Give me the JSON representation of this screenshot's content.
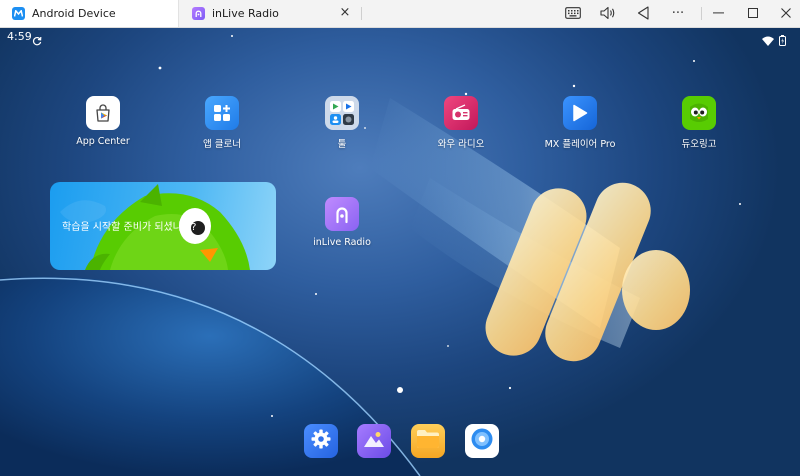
{
  "tabs": [
    {
      "label": "Android Device",
      "active": true
    },
    {
      "label": "inLive Radio",
      "active": false
    }
  ],
  "toolbar": {
    "close_tab_glyph": "×",
    "more_glyph": "···",
    "minimize_glyph": "—",
    "maximize_glyph": "☐",
    "close_glyph": "✕"
  },
  "status": {
    "time": "4:59"
  },
  "apps": [
    {
      "label": "App Center",
      "icon": "play-store-icon"
    },
    {
      "label": "앱 클로너",
      "icon": "app-cloner-icon"
    },
    {
      "label": "툴",
      "icon": "tools-folder-icon"
    },
    {
      "label": "와우 라디오",
      "icon": "radio-icon"
    },
    {
      "label": "MX 플레이어 Pro",
      "icon": "mx-player-icon"
    },
    {
      "label": "듀오링고",
      "icon": "duolingo-icon"
    },
    {
      "label": "inLive Radio",
      "icon": "inlive-radio-icon"
    }
  ],
  "widget": {
    "text": "학습을 시작할 준비가 되셨나요?"
  },
  "dock": [
    {
      "icon": "settings-icon"
    },
    {
      "icon": "gallery-icon"
    },
    {
      "icon": "file-manager-icon"
    },
    {
      "icon": "music-player-icon"
    }
  ],
  "colors": {
    "accent_blue": "#1d8ff2",
    "wallpaper_dark": "#113460",
    "duolingo_green": "#58cc02",
    "radio_red": "#d6336c"
  }
}
